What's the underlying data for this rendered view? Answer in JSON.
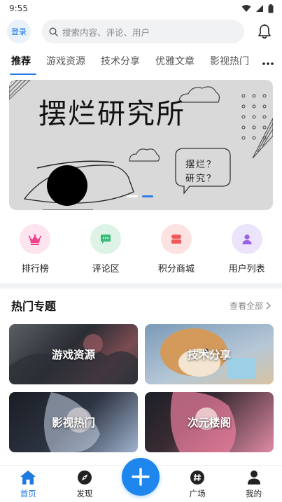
{
  "status": {
    "time": "9:55"
  },
  "header": {
    "login_label": "登录",
    "search_placeholder": "搜索内容、评论、用户"
  },
  "tabs": [
    {
      "label": "推荐",
      "active": true
    },
    {
      "label": "游戏资源"
    },
    {
      "label": "技术分享"
    },
    {
      "label": "优雅文章"
    },
    {
      "label": "影视热门"
    }
  ],
  "banner": {
    "title": "摆烂研究所",
    "bubble_line1": "摆烂？",
    "bubble_line2": "研究？",
    "slides": 2,
    "active_slide": 1
  },
  "quick": [
    {
      "label": "排行榜",
      "icon": "crown-icon",
      "bg": "#fde4ee",
      "color": "#f0448a"
    },
    {
      "label": "评论区",
      "icon": "comment-icon",
      "bg": "#ddf3e6",
      "color": "#3dbb78"
    },
    {
      "label": "积分商城",
      "icon": "shop-icon",
      "bg": "#fde2e2",
      "color": "#ee5a5a"
    },
    {
      "label": "用户列表",
      "icon": "user-icon",
      "bg": "#ece4fb",
      "color": "#9a63e6"
    }
  ],
  "hot": {
    "title": "热门专题",
    "see_all": "查看全部",
    "cards": [
      {
        "label": "游戏资源"
      },
      {
        "label": "技术分享"
      },
      {
        "label": "影视热门"
      },
      {
        "label": "次元楼阁"
      }
    ]
  },
  "nav": [
    {
      "label": "首页",
      "icon": "home-icon",
      "active": true
    },
    {
      "label": "发现",
      "icon": "compass-icon"
    },
    {
      "label": "广场",
      "icon": "hashtag-icon"
    },
    {
      "label": "我的",
      "icon": "profile-icon"
    }
  ],
  "colors": {
    "accent": "#1f7ae0",
    "fab": "#1f86ee"
  }
}
